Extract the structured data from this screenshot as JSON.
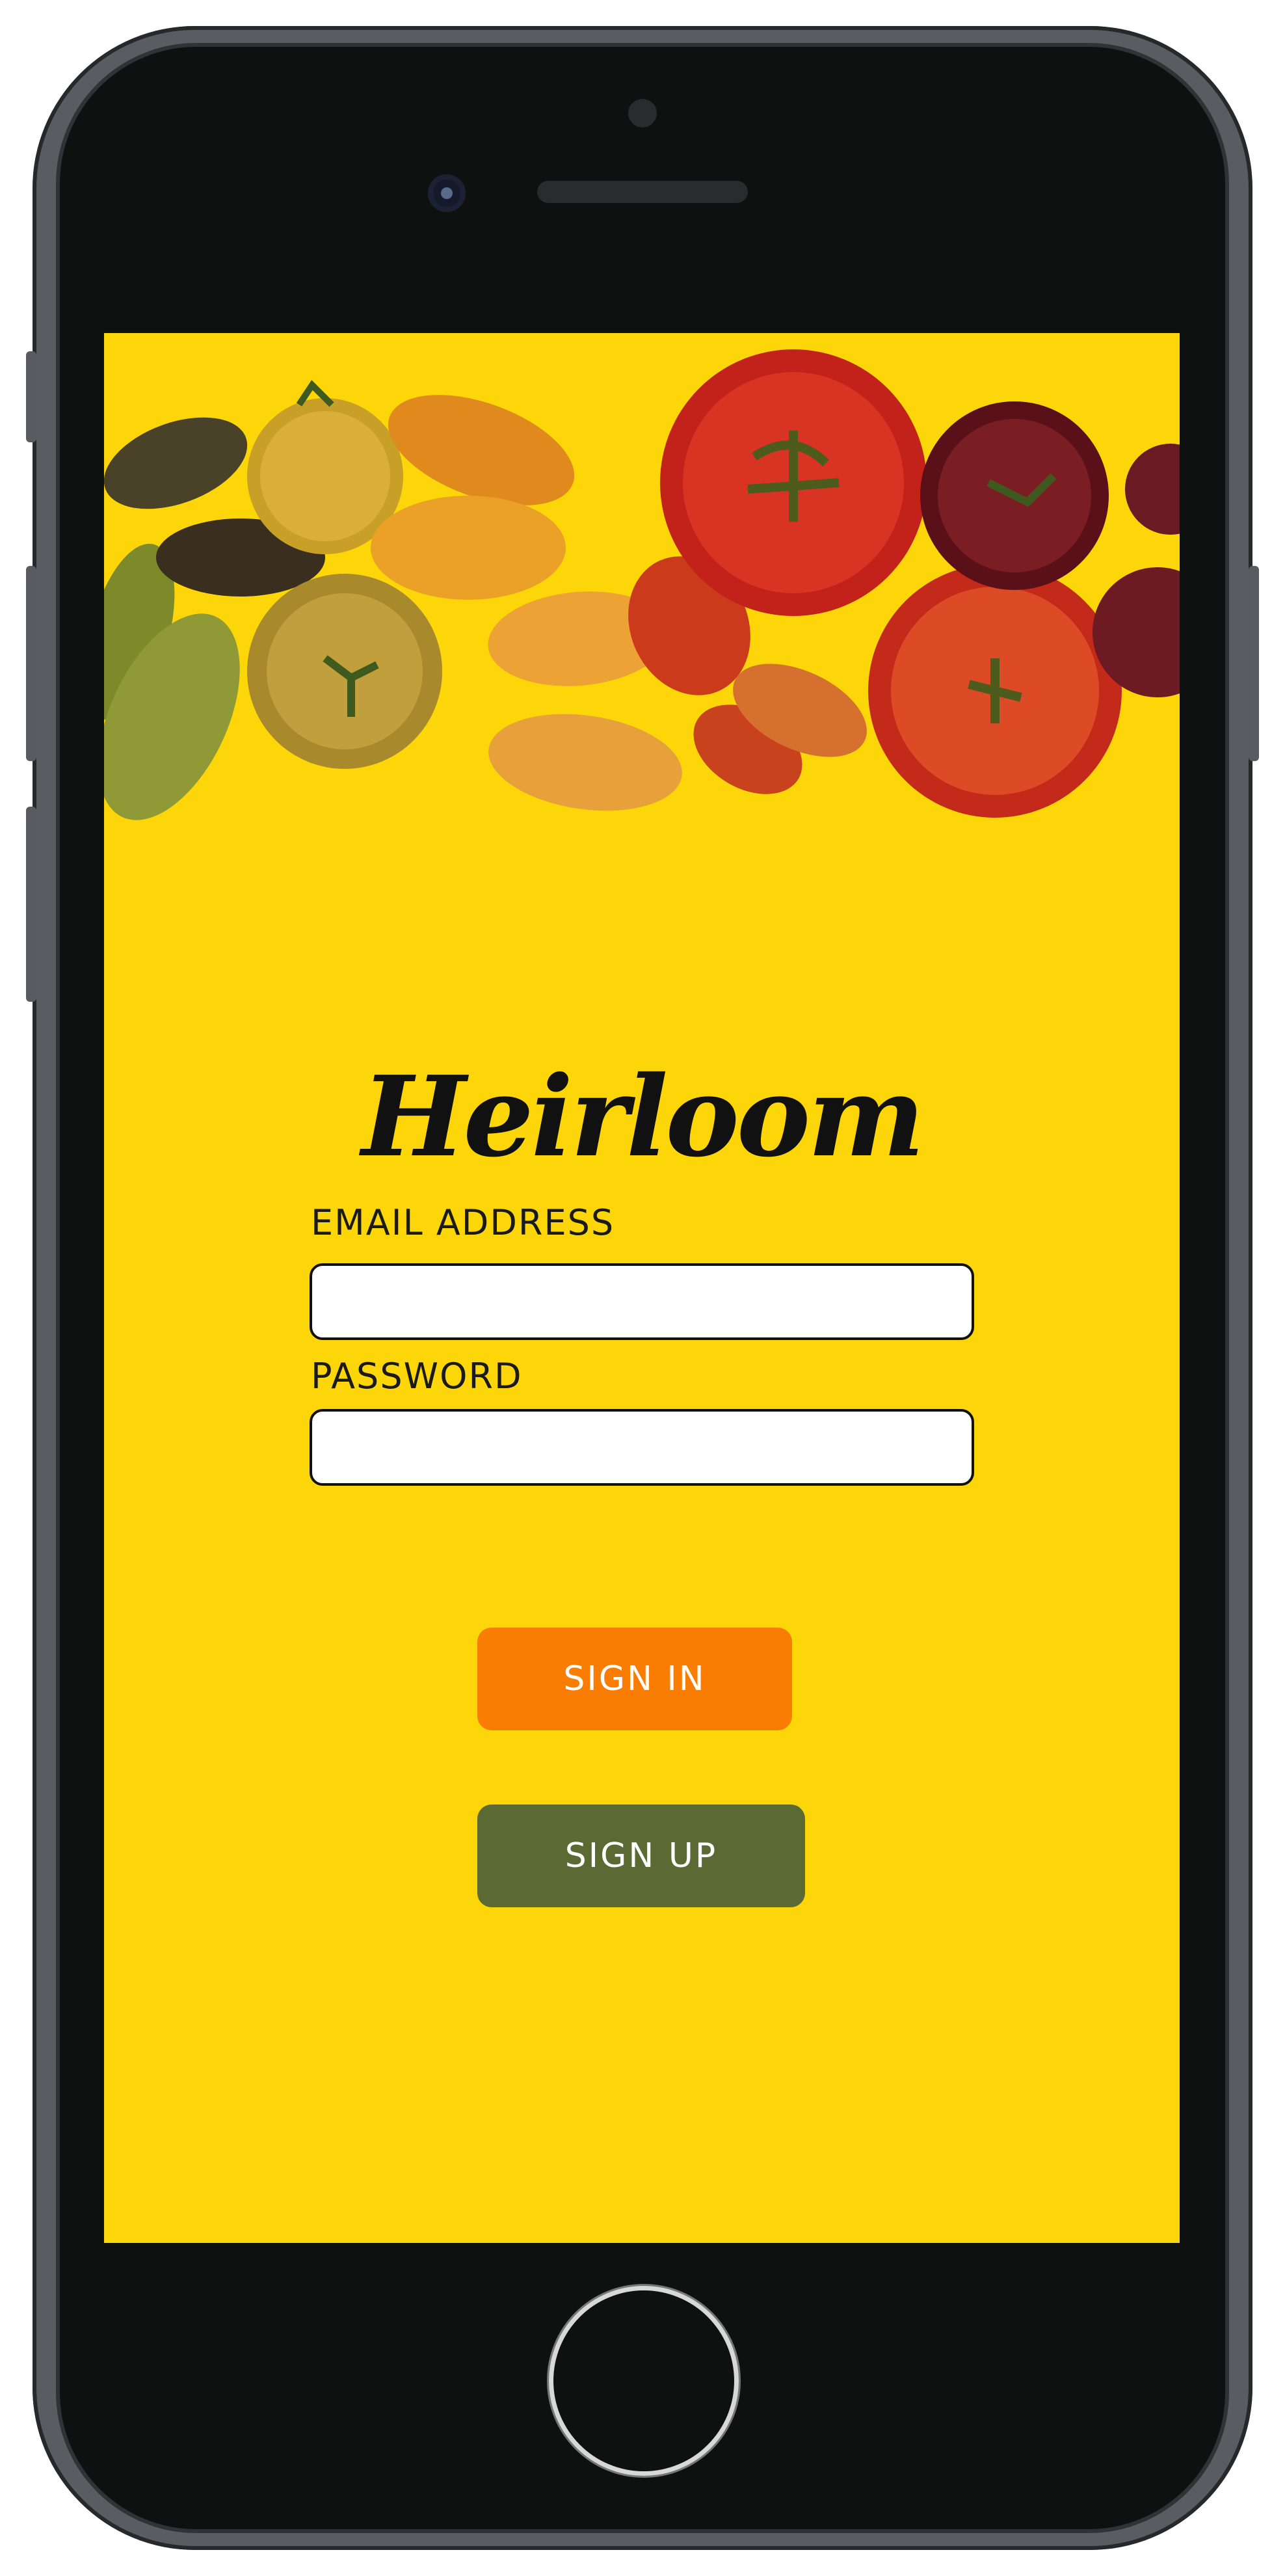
{
  "app": {
    "name": "Heirloom",
    "theme_color": "#fdd60a"
  },
  "login_form": {
    "email_label": "EMAIL ADDRESS",
    "email_value": "",
    "email_placeholder": "",
    "password_label": "PASSWORD",
    "password_value": "",
    "password_placeholder": ""
  },
  "actions": {
    "sign_in_label": "SIGN IN",
    "sign_in_color": "#f97d03",
    "sign_up_label": "SIGN UP",
    "sign_up_color": "#5b6a32"
  },
  "banner": {
    "image": "heirloom-tomatoes-photo"
  }
}
